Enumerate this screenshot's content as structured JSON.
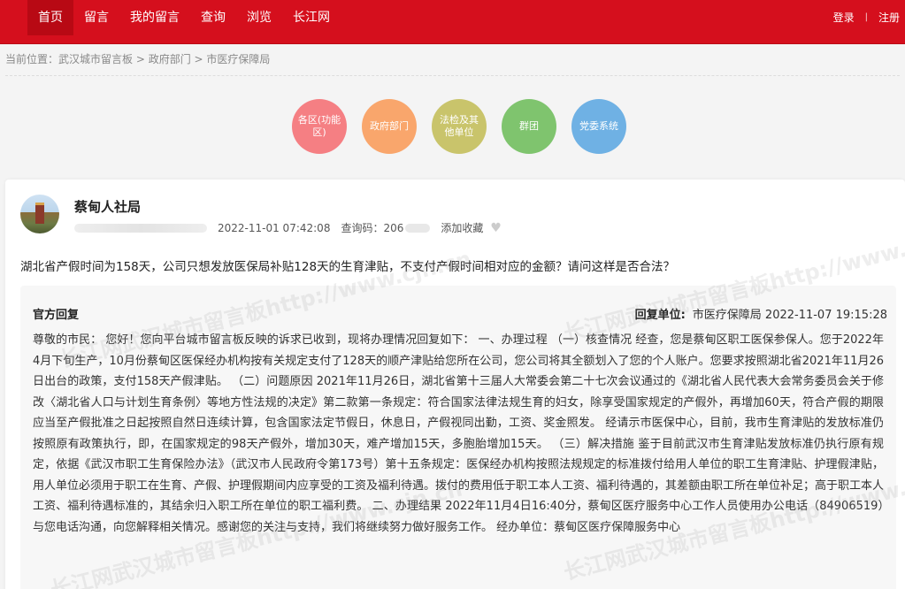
{
  "nav": {
    "items": [
      "首页",
      "留言",
      "我的留言",
      "查询",
      "浏览",
      "长江网"
    ],
    "active_index": 0,
    "login": "登录",
    "separator": "|",
    "register": "注册"
  },
  "breadcrumb": {
    "prefix": "当前位置：",
    "items": [
      "武汉城市留言板",
      "政府部门",
      "市医疗保障局"
    ],
    "sep": " > "
  },
  "categories": [
    {
      "label": "各区(功能区)",
      "color": "#f57f83"
    },
    {
      "label": "政府部门",
      "color": "#f9a66c"
    },
    {
      "label": "法检及其他单位",
      "color": "#c9c46b"
    },
    {
      "label": "群团",
      "color": "#7fc46e"
    },
    {
      "label": "党委系统",
      "color": "#6fb1e4"
    }
  ],
  "post": {
    "org_name": "蔡甸人社局",
    "datetime": "2022-11-01 07:42:08",
    "query_label": "查询码：",
    "query_code": "206",
    "fav_label": "添加收藏",
    "question": "湖北省产假时间为158天，公司只想发放医保局补贴128天的生育津贴，不支付产假时间相对应的金额？请问这样是否合法？"
  },
  "reply": {
    "title": "官方回复",
    "unit_label": "回复单位:",
    "unit": "市医疗保障局",
    "datetime": "2022-11-07 19:15:28",
    "body": "尊敬的市民： 您好！您向平台城市留言板反映的诉求已收到，现将办理情况回复如下： 一、办理过程 （一）核查情况 经查，您是蔡甸区职工医保参保人。您于2022年4月下旬生产，10月份蔡甸区医保经办机构按有关规定支付了128天的顺产津贴给您所在公司，您公司将其全额划入了您的个人账户。您要求按照湖北省2021年11月26日出台的政策，支付158天产假津贴。 （二）问题原因 2021年11月26日，湖北省第十三届人大常委会第二十七次会议通过的《湖北省人民代表大会常务委员会关于修改〈湖北省人口与计划生育条例〉等地方性法规的决定》第二款第一条规定：符合国家法律法规生育的妇女，除享受国家规定的产假外，再增加60天，符合产假的期限应当至产假批准之日起按照自然日连续计算，包含国家法定节假日，休息日，产假视同出勤，工资、奖金照发。 经请示市医保中心，目前，我市生育津贴的发放标准仍按照原有政策执行，即，在国家规定的98天产假外，增加30天，难产增加15天，多胞胎增加15天。 （三）解决措施 鉴于目前武汉市生育津贴发放标准仍执行原有规定，依据《武汉市职工生育保险办法》（武汉市人民政府令第173号）第十五条规定：医保经办机构按照法规规定的标准拨付给用人单位的职工生育津贴、护理假津贴，用人单位必须用于职工在生育、产假、护理假期间内应享受的工资及福利待遇。拨付的费用低于职工本人工资、福利待遇的，其差额由职工所在单位补足；高于职工本人工资、福利待遇标准的，其结余归入职工所在单位的职工福利费。 二、办理结果 2022年11月4日16:40分，蔡甸区医疗服务中心工作人员使用办公电话（84906519）与您电话沟通，向您解释相关情况。感谢您的关注与支持，我们将继续努力做好服务工作。 经办单位：蔡甸区医疗保障服务中心"
  },
  "watermark": "长江网武汉城市留言板http://www.cjn.cn"
}
